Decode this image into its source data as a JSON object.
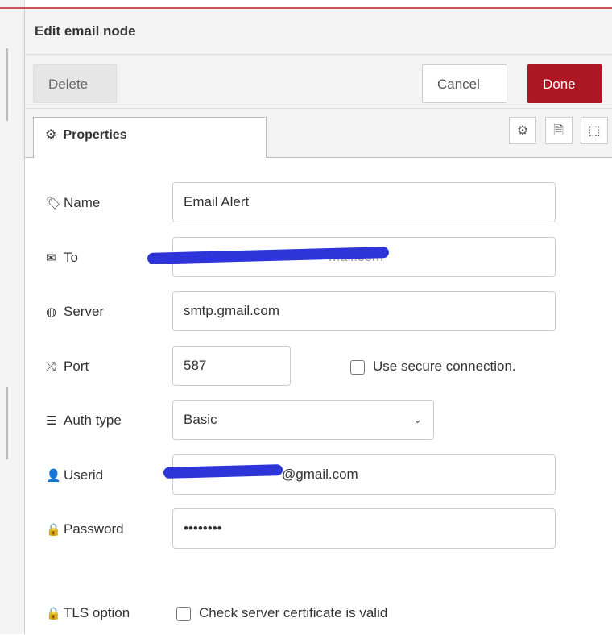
{
  "dialog": {
    "title": "Edit email node"
  },
  "toolbar": {
    "delete_label": "Delete",
    "cancel_label": "Cancel",
    "done_label": "Done"
  },
  "tabs": {
    "properties_label": "Properties"
  },
  "form": {
    "name_label": "Name",
    "name_value": "Email Alert",
    "to_label": "To",
    "to_value": "mail.com",
    "server_label": "Server",
    "server_value": "smtp.gmail.com",
    "port_label": "Port",
    "port_value": "587",
    "secure_label": "Use secure connection.",
    "auth_label": "Auth type",
    "auth_value": "Basic",
    "userid_label": "Userid",
    "userid_value": "@gmail.com",
    "password_label": "Password",
    "password_value": "••••••••",
    "tls_label": "TLS option",
    "tls_check_label": "Check server certificate is valid"
  },
  "colors": {
    "done_button": "#ad1625",
    "redaction": "#2d35d8"
  }
}
